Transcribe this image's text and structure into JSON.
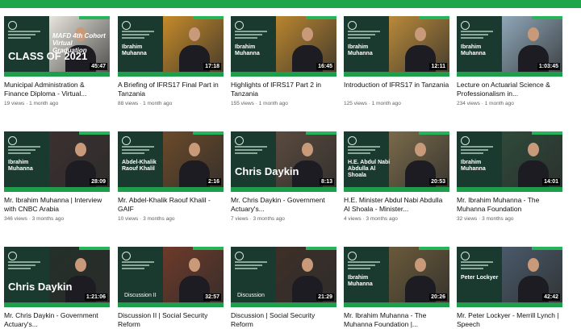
{
  "videos": [
    {
      "title": "Municipal Administration & Finance Diploma - Virtual...",
      "meta": "19 views · 1 month ago",
      "duration": "45:47",
      "thumb_name": "",
      "thumb_overlay": "MAFD 4th Cohort Virtual Graduation",
      "thumb_big": "CLASS OF 2021",
      "photo_color": "#e7e5dc"
    },
    {
      "title": "A Briefing of IFRS17 Final Part in Tanzania",
      "meta": "88 views · 1 month ago",
      "duration": "17:18",
      "thumb_name": "Ibrahim Muhanna",
      "thumb_overlay": "",
      "thumb_big": "",
      "photo_color": "#c58a2a"
    },
    {
      "title": "Highlights of IFRS17 Part 2 in Tanzania",
      "meta": "155 views · 1 month ago",
      "duration": "16:45",
      "thumb_name": "Ibrahim Muhanna",
      "thumb_overlay": "",
      "thumb_big": "",
      "photo_color": "#b9852f"
    },
    {
      "title": "Introduction of IFRS17 in Tanzania",
      "meta": "125 views · 1 month ago",
      "duration": "12:11",
      "thumb_name": "Ibrahim Muhanna",
      "thumb_overlay": "",
      "thumb_big": "",
      "photo_color": "#b98a3a"
    },
    {
      "title": "Lecture on Actuarial Science & Professionalism in...",
      "meta": "234 views · 1 month ago",
      "duration": "1:03:45",
      "thumb_name": "Ibrahim Muhanna",
      "thumb_overlay": "",
      "thumb_big": "",
      "photo_color": "#8fa7b8"
    },
    {
      "title": "Mr. Ibrahim Muhanna | Interview with CNBC Arabia",
      "meta": "346 views · 3 months ago",
      "duration": "28:09",
      "thumb_name": "Ibrahim Muhanna",
      "thumb_overlay": "",
      "thumb_big": "",
      "photo_color": "#3c3030"
    },
    {
      "title": "Mr. Abdel-Khalik Raouf Khalil - GAIF",
      "meta": "10 views · 3 months ago",
      "duration": "2:16",
      "thumb_name": "Abdel-Khalik Raouf Khalil",
      "thumb_overlay": "",
      "thumb_big": "",
      "photo_color": "#6b4a2a"
    },
    {
      "title": "Mr. Chris Daykin - Government Actuary's...",
      "meta": "7 views · 3 months ago",
      "duration": "8:13",
      "thumb_name": "",
      "thumb_overlay": "",
      "thumb_big": "Chris Daykin",
      "photo_color": "#5a4a3e"
    },
    {
      "title": "H.E. Minister Abdul Nabi Abdulla Al Shoala - Minister...",
      "meta": "4 views · 3 months ago",
      "duration": "20:53",
      "thumb_name": "H.E. Abdul Nabi Abdulla Al Shoala",
      "thumb_overlay": "",
      "thumb_big": "",
      "photo_color": "#7a6a4a"
    },
    {
      "title": "Mr. Ibrahim Muhanna - The Muhanna Foundation",
      "meta": "32 views · 3 months ago",
      "duration": "14:01",
      "thumb_name": "Ibrahim Muhanna",
      "thumb_overlay": "",
      "thumb_big": "",
      "photo_color": "#2e4a3a"
    },
    {
      "title": "Mr. Chris Daykin - Government Actuary's...",
      "meta": "",
      "duration": "1:21:06",
      "thumb_name": "",
      "thumb_overlay": "",
      "thumb_big": "Chris Daykin",
      "photo_color": "#24302a"
    },
    {
      "title": "Discussion II | Social Security Reform",
      "meta": "",
      "duration": "32:57",
      "thumb_name": "",
      "thumb_overlay": "Discussion II",
      "thumb_big": "",
      "photo_color": "#6e3a2a"
    },
    {
      "title": "Discussion | Social Security Reform",
      "meta": "",
      "duration": "21:29",
      "thumb_name": "",
      "thumb_overlay": "Discussion",
      "thumb_big": "",
      "photo_color": "#3e3028"
    },
    {
      "title": "Mr. Ibrahim Muhanna - The Muhanna Foundation |...",
      "meta": "",
      "duration": "20:26",
      "thumb_name": "Ibrahim Muhanna",
      "thumb_overlay": "",
      "thumb_big": "",
      "photo_color": "#6a5a3a"
    },
    {
      "title": "Mr. Peter Lockyer - Merrill Lynch | Speech",
      "meta": "",
      "duration": "42:42",
      "thumb_name": "Peter Lockyer",
      "thumb_overlay": "",
      "thumb_big": "",
      "photo_color": "#4a5a6a"
    }
  ]
}
